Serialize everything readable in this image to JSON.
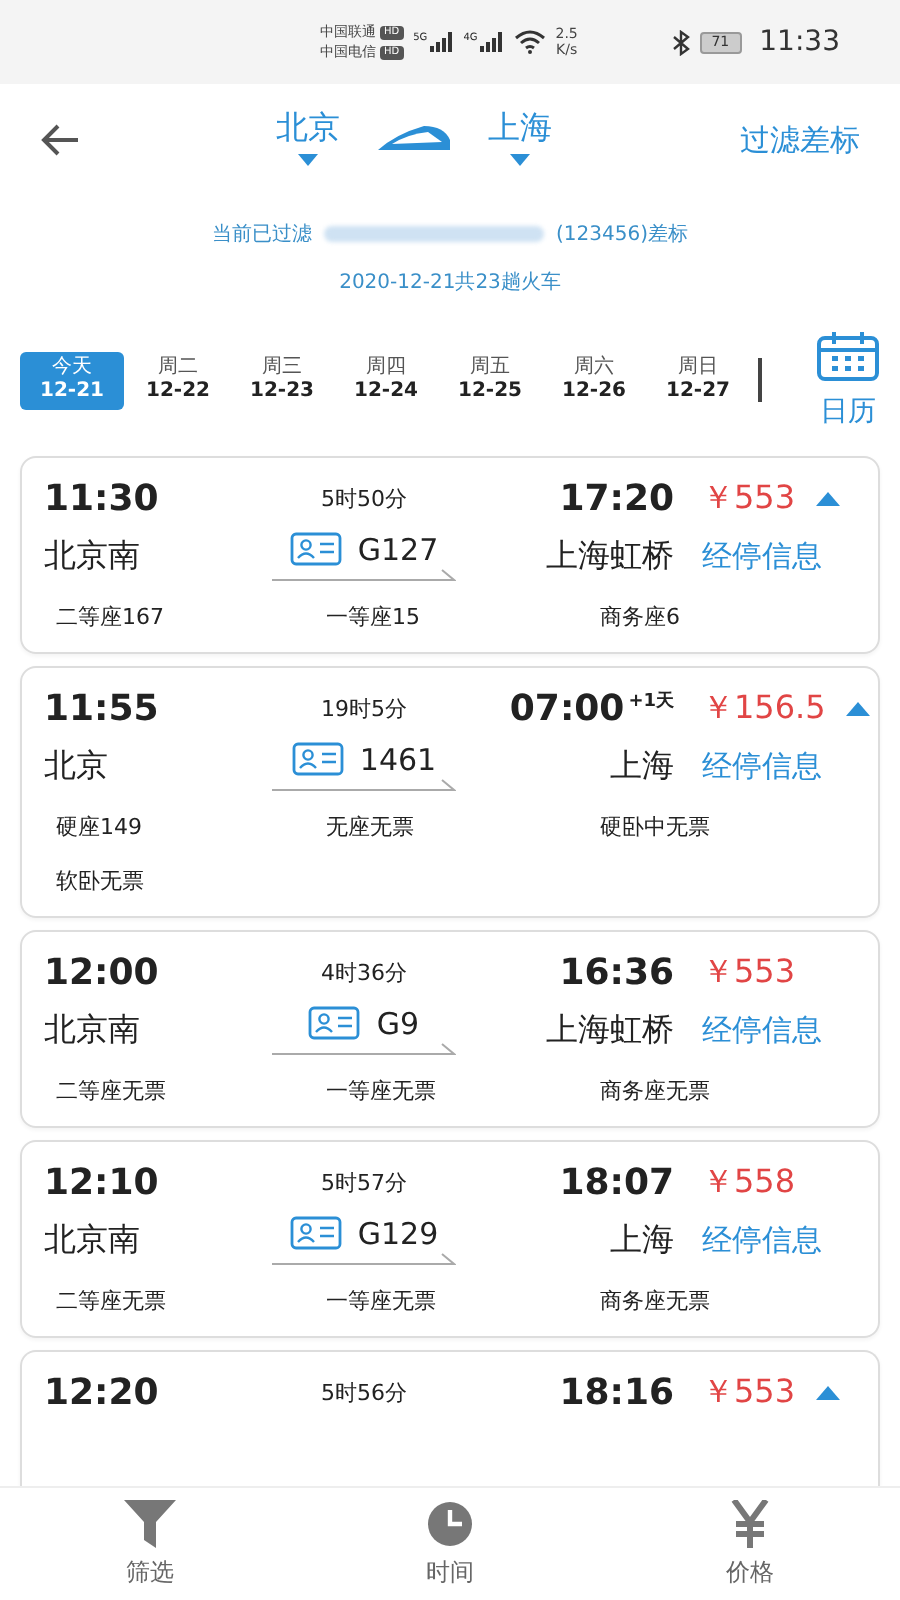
{
  "status_bar": {
    "carriers": [
      {
        "name": "中国联通",
        "hd": "HD"
      },
      {
        "name": "中国电信",
        "hd": "HD"
      }
    ],
    "networks": [
      "5G",
      "4G"
    ],
    "speed": "2.5",
    "speed_unit": "K/s",
    "battery": "71",
    "time": "11:33"
  },
  "header": {
    "from": "北京",
    "to": "上海",
    "filter_link": "过滤差标"
  },
  "filter_note": {
    "prefix": "当前已过滤",
    "suffix": "(123456)差标"
  },
  "summary": "2020-12-21共23趟火车",
  "dates": [
    {
      "day": "今天",
      "date": "12-21",
      "selected": true
    },
    {
      "day": "周二",
      "date": "12-22",
      "selected": false
    },
    {
      "day": "周三",
      "date": "12-23",
      "selected": false
    },
    {
      "day": "周四",
      "date": "12-24",
      "selected": false
    },
    {
      "day": "周五",
      "date": "12-25",
      "selected": false
    },
    {
      "day": "周六",
      "date": "12-26",
      "selected": false
    },
    {
      "day": "周日",
      "date": "12-27",
      "selected": false
    }
  ],
  "calendar_label": "日历",
  "trains": [
    {
      "depart": "11:30",
      "duration": "5时50分",
      "arrive": "17:20",
      "price": "￥553",
      "caret": true,
      "from": "北京南",
      "number": "G127",
      "to": "上海虹桥",
      "stops": "经停信息",
      "seats": [
        "二等座167",
        "一等座15",
        "商务座6"
      ]
    },
    {
      "depart": "11:55",
      "duration": "19时5分",
      "arrive": "07:00",
      "next_day": "+1天",
      "price": "￥156.5",
      "caret": true,
      "from": "北京",
      "number": "1461",
      "to": "上海",
      "stops": "经停信息",
      "seats": [
        "硬座149",
        "无座无票",
        "硬卧中无票",
        "软卧无票"
      ]
    },
    {
      "depart": "12:00",
      "duration": "4时36分",
      "arrive": "16:36",
      "price": "￥553",
      "caret": false,
      "from": "北京南",
      "number": "G9",
      "to": "上海虹桥",
      "stops": "经停信息",
      "seats": [
        "二等座无票",
        "一等座无票",
        "商务座无票"
      ]
    },
    {
      "depart": "12:10",
      "duration": "5时57分",
      "arrive": "18:07",
      "price": "￥558",
      "caret": false,
      "from": "北京南",
      "number": "G129",
      "to": "上海",
      "stops": "经停信息",
      "seats": [
        "二等座无票",
        "一等座无票",
        "商务座无票"
      ]
    },
    {
      "depart": "12:20",
      "duration": "5时56分",
      "arrive": "18:16",
      "price": "￥553",
      "caret": true
    }
  ],
  "bottom_nav": [
    {
      "kind": "filter",
      "label": "筛选"
    },
    {
      "kind": "time",
      "label": "时间"
    },
    {
      "kind": "price",
      "label": "价格"
    }
  ]
}
